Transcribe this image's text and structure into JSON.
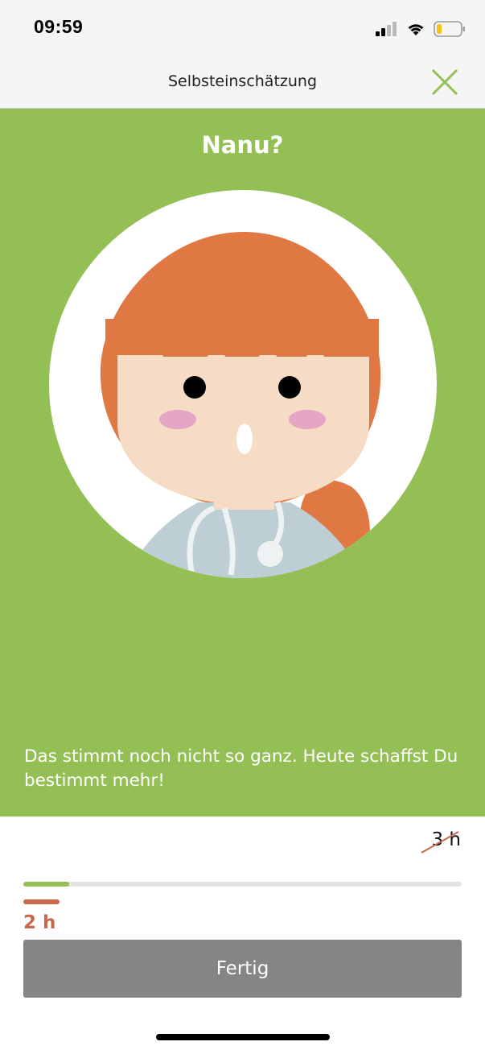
{
  "status_bar": {
    "time": "09:59",
    "icons": [
      "cellular-signal-icon",
      "wifi-icon",
      "battery-icon"
    ],
    "battery_color": "#f5c518"
  },
  "nav": {
    "title": "Selbsteinschätzung",
    "close_icon": "close-icon",
    "accent_color": "#93bf55"
  },
  "hero": {
    "title": "Nanu?",
    "illustration": "doctor-avatar-illustration",
    "message": "Das stimmt noch nicht so ganz. Heute schaffst Du bestimmt mehr!",
    "background_color": "#93bf55"
  },
  "progress": {
    "target_label": "3 h",
    "actual_label": "2 h",
    "fill_fraction": 0.105,
    "fill_color": "#93bf55",
    "actual_color": "#c8674a"
  },
  "actions": {
    "done_label": "Fertig"
  }
}
